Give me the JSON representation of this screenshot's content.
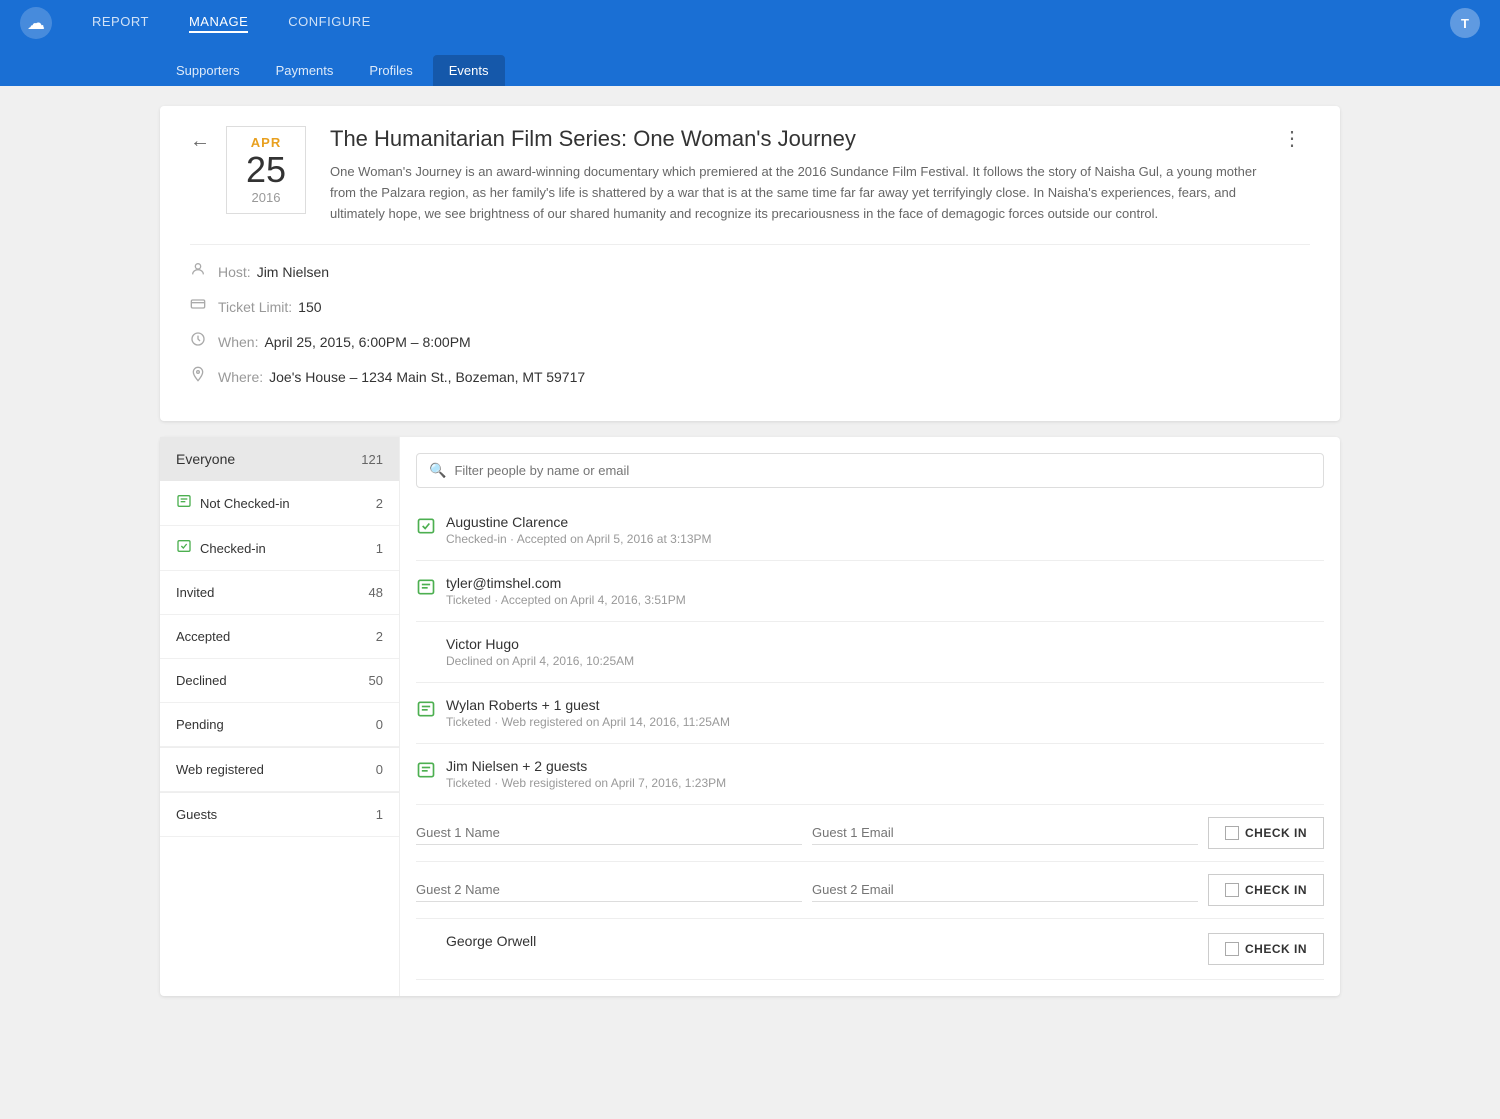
{
  "app": {
    "logo_icon": "☁",
    "user_initial": "T"
  },
  "top_nav": {
    "links": [
      {
        "id": "report",
        "label": "REPORT",
        "active": false
      },
      {
        "id": "manage",
        "label": "MANAGE",
        "active": true
      },
      {
        "id": "configure",
        "label": "CONFIGURE",
        "active": false
      }
    ]
  },
  "sub_nav": {
    "links": [
      {
        "id": "supporters",
        "label": "Supporters",
        "active": false
      },
      {
        "id": "payments",
        "label": "Payments",
        "active": false
      },
      {
        "id": "profiles",
        "label": "Profiles",
        "active": false
      },
      {
        "id": "events",
        "label": "Events",
        "active": true
      }
    ]
  },
  "event": {
    "date_month": "APR",
    "date_day": "25",
    "date_year": "2016",
    "title": "The Humanitarian Film Series: One Woman's Journey",
    "description": "One Woman's Journey is an award-winning documentary which premiered at the 2016 Sundance Film Festival. It follows the story of Naisha Gul, a young mother from the Palzara region, as her family's life is shattered by a war that is at the same time far far away yet terrifyingly close.  In Naisha's experiences, fears, and ultimately hope, we see brightness of our shared humanity and recognize its precariousness in the face of demagogic forces outside our control.",
    "host_label": "Host:",
    "host_value": "Jim Nielsen",
    "ticket_label": "Ticket Limit:",
    "ticket_value": "150",
    "when_label": "When:",
    "when_value": "April 25, 2015, 6:00PM – 8:00PM",
    "where_label": "Where:",
    "where_value": "Joe's House – 1234 Main St., Bozeman, MT 59717"
  },
  "sidebar": {
    "everyone_label": "Everyone",
    "everyone_count": "121",
    "items": [
      {
        "id": "not-checked-in",
        "icon": "ticket",
        "label": "Not Checked-in",
        "count": "2"
      },
      {
        "id": "checked-in",
        "icon": "ticket-check",
        "label": "Checked-in",
        "count": "1"
      }
    ],
    "dividers": [
      {
        "id": "invited",
        "label": "Invited",
        "count": "48"
      },
      {
        "id": "accepted",
        "label": "Accepted",
        "count": "2"
      },
      {
        "id": "declined",
        "label": "Declined",
        "count": "50"
      },
      {
        "id": "pending",
        "label": "Pending",
        "count": "0"
      }
    ],
    "web_registered_label": "Web registered",
    "web_registered_count": "0",
    "guests_label": "Guests",
    "guests_count": "1"
  },
  "search": {
    "placeholder": "Filter people by name or email"
  },
  "people": [
    {
      "id": "p1",
      "has_icon": true,
      "checked": true,
      "name": "Augustine Clarence",
      "sub": "Checked-in · Accepted on April 5, 2016 at 3:13PM"
    },
    {
      "id": "p2",
      "has_icon": true,
      "checked": false,
      "name": "tyler@timshel.com",
      "sub": "Ticketed · Accepted on April 4, 2016, 3:51PM"
    },
    {
      "id": "p3",
      "has_icon": false,
      "checked": false,
      "name": "Victor Hugo",
      "sub": "Declined on April 4, 2016, 10:25AM"
    },
    {
      "id": "p4",
      "has_icon": true,
      "checked": false,
      "name": "Wylan Roberts + 1 guest",
      "sub": "Ticketed · Web registered on April 14, 2016, 11:25AM"
    },
    {
      "id": "p5",
      "has_icon": true,
      "checked": false,
      "name": "Jim Nielsen + 2 guests",
      "sub": "Ticketed · Web resigistered on April 7, 2016, 1:23PM"
    }
  ],
  "guest_rows": [
    {
      "id": "guest1",
      "name_placeholder": "Guest 1 Name",
      "email_placeholder": "Guest 1 Email",
      "checkin_label": "CHECK IN"
    },
    {
      "id": "guest2",
      "name_placeholder": "Guest 2 Name",
      "email_placeholder": "Guest 2 Email",
      "checkin_label": "CHECK IN"
    }
  ],
  "george_orwell": {
    "name": "George Orwell",
    "checkin_label": "CHECK IN"
  }
}
